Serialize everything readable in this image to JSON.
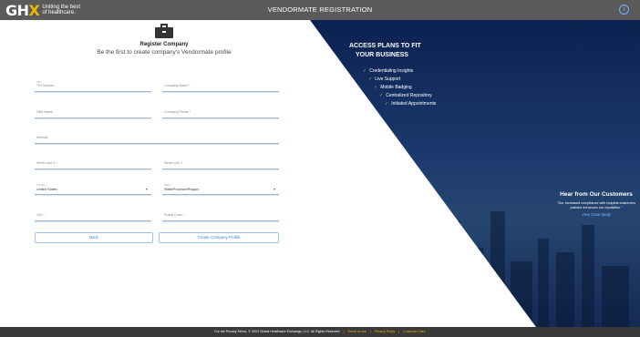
{
  "header": {
    "logo_text": "GHX",
    "logo_tagline": "Uniting the best of healthcare.",
    "app_title": "VENDORMATE REGISTRATION",
    "info_icon": "info-icon"
  },
  "hero": {
    "plans_title_line1": "ACCESS PLANS TO FIT",
    "plans_title_line2": "YOUR BUSINESS",
    "plans": [
      "Credentialing Insights",
      "Live Support",
      "Mobile Badging",
      "Centralized Repository",
      "Initiated Appointments"
    ],
    "testimonial_title": "Hear from Our Customers",
    "testimonial_quote": "\"Our increased compliance with hospital customers policies enhances our reputation.\"",
    "testimonial_link": "View Case Study"
  },
  "form": {
    "title": "Register Company",
    "subtitle": "Be the first to create company's Vendormate profile",
    "tin_small_label": "TIN",
    "tin_placeholder": "TIN Number",
    "company_name": "Company Name *",
    "dba_name": "DBA Name",
    "company_phone": "Company Phone *",
    "website": "Website",
    "street1": "Street Line 1 *",
    "street2": "Street Line 2",
    "country_label": "Country *",
    "country_value": "United States",
    "state_label": "State *",
    "state_value": "State/Province/Region",
    "city": "City *",
    "postal": "Postal Code *",
    "back_button": "Back",
    "create_button": "Create Company Profile"
  },
  "footer": {
    "copyright": "For the Privacy Terms, © 2023 Global Healthcare Exchange, LLC. All Rights Reserved",
    "links": [
      "Terms of use",
      "Privacy Policy",
      "Customer Care"
    ]
  }
}
